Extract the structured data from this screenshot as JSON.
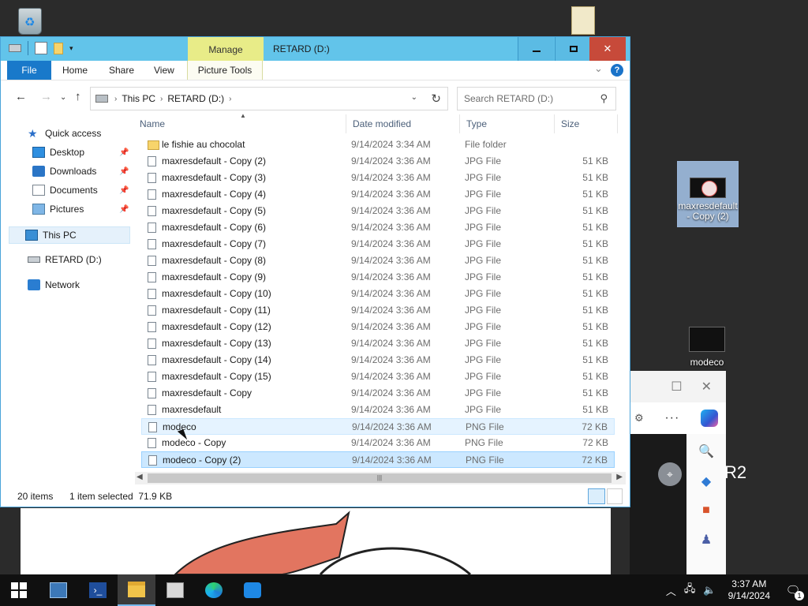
{
  "desktop": {
    "icons": [
      {
        "label": ""
      },
      {
        "label": ""
      },
      {
        "label": "maxresdefault - Copy (2)"
      },
      {
        "label": "modeco"
      }
    ],
    "background_text": "R2"
  },
  "explorer": {
    "context_tab": "Manage",
    "title": "RETARD (D:)",
    "window_controls": {
      "minimize": "—",
      "close": "✕"
    },
    "ribbon": {
      "file": "File",
      "home": "Home",
      "share": "Share",
      "view": "View",
      "picture_tools": "Picture Tools"
    },
    "address": {
      "crumbs": [
        "This PC",
        "RETARD (D:)"
      ]
    },
    "search": {
      "placeholder": "Search RETARD (D:)"
    },
    "nav": {
      "quick_access": "Quick access",
      "desktop": "Desktop",
      "downloads": "Downloads",
      "documents": "Documents",
      "pictures": "Pictures",
      "this_pc": "This PC",
      "drive": "RETARD (D:)",
      "network": "Network"
    },
    "columns": {
      "name": "Name",
      "date": "Date modified",
      "type": "Type",
      "size": "Size"
    },
    "files": [
      {
        "name": "le fishie au chocolat",
        "date": "9/14/2024 3:34 AM",
        "type": "File folder",
        "size": ""
      },
      {
        "name": "maxresdefault - Copy (2)",
        "date": "9/14/2024 3:36 AM",
        "type": "JPG File",
        "size": "51 KB"
      },
      {
        "name": "maxresdefault - Copy (3)",
        "date": "9/14/2024 3:36 AM",
        "type": "JPG File",
        "size": "51 KB"
      },
      {
        "name": "maxresdefault - Copy (4)",
        "date": "9/14/2024 3:36 AM",
        "type": "JPG File",
        "size": "51 KB"
      },
      {
        "name": "maxresdefault - Copy (5)",
        "date": "9/14/2024 3:36 AM",
        "type": "JPG File",
        "size": "51 KB"
      },
      {
        "name": "maxresdefault - Copy (6)",
        "date": "9/14/2024 3:36 AM",
        "type": "JPG File",
        "size": "51 KB"
      },
      {
        "name": "maxresdefault - Copy (7)",
        "date": "9/14/2024 3:36 AM",
        "type": "JPG File",
        "size": "51 KB"
      },
      {
        "name": "maxresdefault - Copy (8)",
        "date": "9/14/2024 3:36 AM",
        "type": "JPG File",
        "size": "51 KB"
      },
      {
        "name": "maxresdefault - Copy (9)",
        "date": "9/14/2024 3:36 AM",
        "type": "JPG File",
        "size": "51 KB"
      },
      {
        "name": "maxresdefault - Copy (10)",
        "date": "9/14/2024 3:36 AM",
        "type": "JPG File",
        "size": "51 KB"
      },
      {
        "name": "maxresdefault - Copy (11)",
        "date": "9/14/2024 3:36 AM",
        "type": "JPG File",
        "size": "51 KB"
      },
      {
        "name": "maxresdefault - Copy (12)",
        "date": "9/14/2024 3:36 AM",
        "type": "JPG File",
        "size": "51 KB"
      },
      {
        "name": "maxresdefault - Copy (13)",
        "date": "9/14/2024 3:36 AM",
        "type": "JPG File",
        "size": "51 KB"
      },
      {
        "name": "maxresdefault - Copy (14)",
        "date": "9/14/2024 3:36 AM",
        "type": "JPG File",
        "size": "51 KB"
      },
      {
        "name": "maxresdefault - Copy (15)",
        "date": "9/14/2024 3:36 AM",
        "type": "JPG File",
        "size": "51 KB"
      },
      {
        "name": "maxresdefault - Copy",
        "date": "9/14/2024 3:36 AM",
        "type": "JPG File",
        "size": "51 KB"
      },
      {
        "name": "maxresdefault",
        "date": "9/14/2024 3:36 AM",
        "type": "JPG File",
        "size": "51 KB"
      },
      {
        "name": "modeco",
        "date": "9/14/2024 3:36 AM",
        "type": "PNG File",
        "size": "72 KB"
      },
      {
        "name": "modeco - Copy",
        "date": "9/14/2024 3:36 AM",
        "type": "PNG File",
        "size": "72 KB"
      },
      {
        "name": "modeco - Copy (2)",
        "date": "9/14/2024 3:36 AM",
        "type": "PNG File",
        "size": "72 KB"
      }
    ],
    "status": {
      "count": "20 items",
      "selection": "1 item selected  71.9 KB"
    }
  },
  "taskbar": {
    "time": "3:37 AM",
    "date": "9/14/2024",
    "notification_count": "1",
    "colors": {
      "background": "#101010",
      "active_indicator": "#76b9ed"
    }
  },
  "colors": {
    "titlebar": "#62c4ea",
    "manage_tab": "#e8ec88",
    "file_tab": "#1979ca",
    "close_button": "#c74a3a",
    "selection": "#cce8ff"
  }
}
